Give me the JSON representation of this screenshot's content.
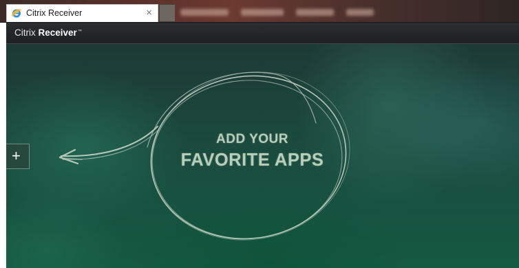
{
  "browser": {
    "active_tab": {
      "title": "Citrix Receiver",
      "favicon": "ie-icon",
      "close_glyph": "×"
    }
  },
  "app": {
    "brand_light": "Citrix",
    "brand_bold": "Receiver",
    "brand_mark": "™"
  },
  "main": {
    "headline_line1": "ADD YOUR",
    "headline_line2": "FAVORITE APPS",
    "add_button_glyph": "+"
  },
  "colors": {
    "headline": "#b9cdbb",
    "background": "#1b4a3e",
    "header": "#22272a"
  }
}
